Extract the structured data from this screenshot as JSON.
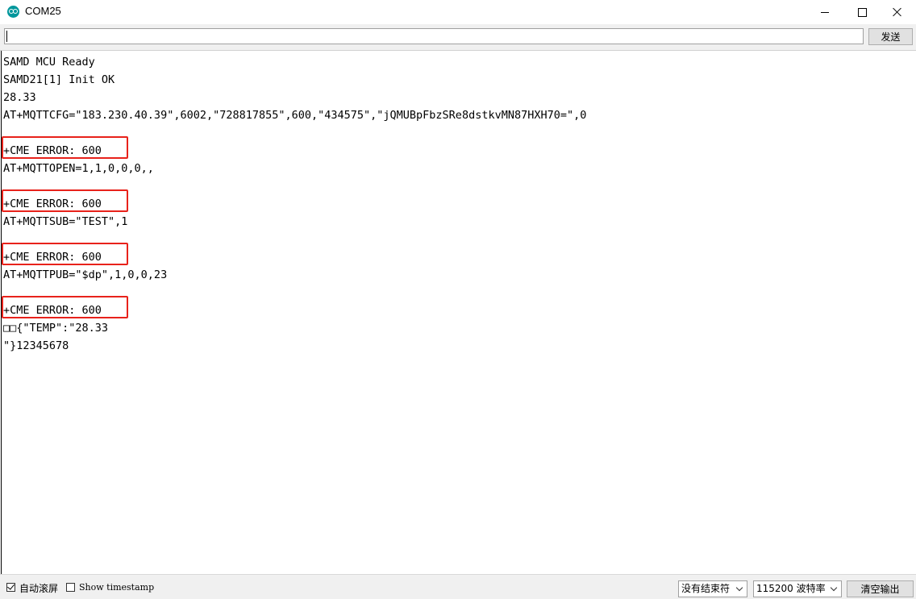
{
  "window": {
    "title": "COM25"
  },
  "toolbar": {
    "input_value": "",
    "send_label": "发送"
  },
  "output": {
    "lines": [
      "SAMD MCU Ready",
      "SAMD21[1] Init OK",
      "28.33",
      "AT+MQTTCFG=\"183.230.40.39\",6002,\"728817855\",600,\"434575\",\"jQMUBpFbzSRe8dstkvMN87HXH70=\",0",
      "",
      "+CME ERROR: 600",
      "AT+MQTTOPEN=1,1,0,0,0,,",
      "",
      "+CME ERROR: 600",
      "AT+MQTTSUB=\"TEST\",1",
      "",
      "+CME ERROR: 600",
      "AT+MQTTPUB=\"$dp\",1,0,0,23",
      "",
      "+CME ERROR: 600",
      "□□{\"TEMP\":\"28.33",
      "\"}12345678"
    ],
    "highlight_color": "#e8221b"
  },
  "statusbar": {
    "autoscroll_label": "自动滚屏",
    "autoscroll_checked": true,
    "timestamp_label": "Show timestamp",
    "timestamp_checked": false,
    "line_ending_value": "没有结束符",
    "baud_value": "115200 波特率",
    "clear_label": "清空输出"
  }
}
